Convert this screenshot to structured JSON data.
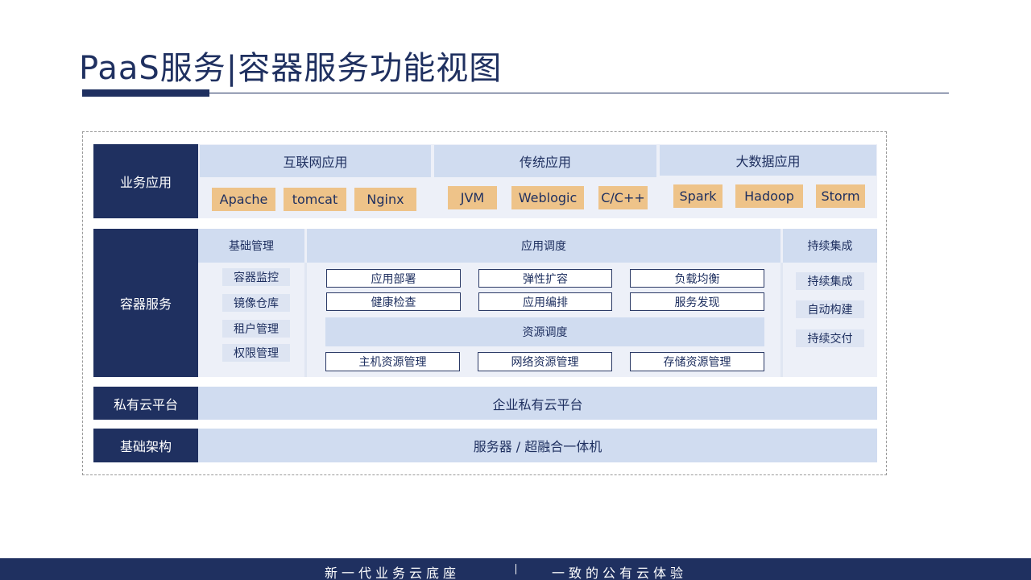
{
  "title": "PaaS服务|容器服务功能视图",
  "business": {
    "side_label": "业务应用",
    "groups": [
      {
        "header": "互联网应用",
        "items": [
          "Apache",
          "tomcat",
          "Nginx"
        ]
      },
      {
        "header": "传统应用",
        "items": [
          "JVM",
          "Weblogic",
          "C/C++"
        ]
      },
      {
        "header": "大数据应用",
        "items": [
          "Spark",
          "Hadoop",
          "Storm"
        ]
      }
    ]
  },
  "container": {
    "side_label": "容器服务",
    "basic": {
      "header": "基础管理",
      "items": [
        "容器监控",
        "镜像仓库",
        "租户管理",
        "权限管理"
      ]
    },
    "app": {
      "header": "应用调度",
      "row1": [
        "应用部署",
        "弹性扩容",
        "负载均衡"
      ],
      "row2": [
        "健康检查",
        "应用编排",
        "服务发现"
      ],
      "resource_header": "资源调度",
      "row3": [
        "主机资源管理",
        "网络资源管理",
        "存储资源管理"
      ]
    },
    "ci": {
      "header": "持续集成",
      "items": [
        "持续集成",
        "自动构建",
        "持续交付"
      ]
    }
  },
  "private_cloud": {
    "side_label": "私有云平台",
    "content": "企业私有云平台"
  },
  "infrastructure": {
    "side_label": "基础架构",
    "content": "服务器 / 超融合一体机"
  },
  "footer": {
    "left": "新一代业务云底座",
    "right": "一致的公有云体验"
  },
  "colors": {
    "navy": "#1f3060",
    "header_blue": "#d0dcf0",
    "panel_bg": "#edf0f8",
    "chip_orange": "#eec389"
  }
}
